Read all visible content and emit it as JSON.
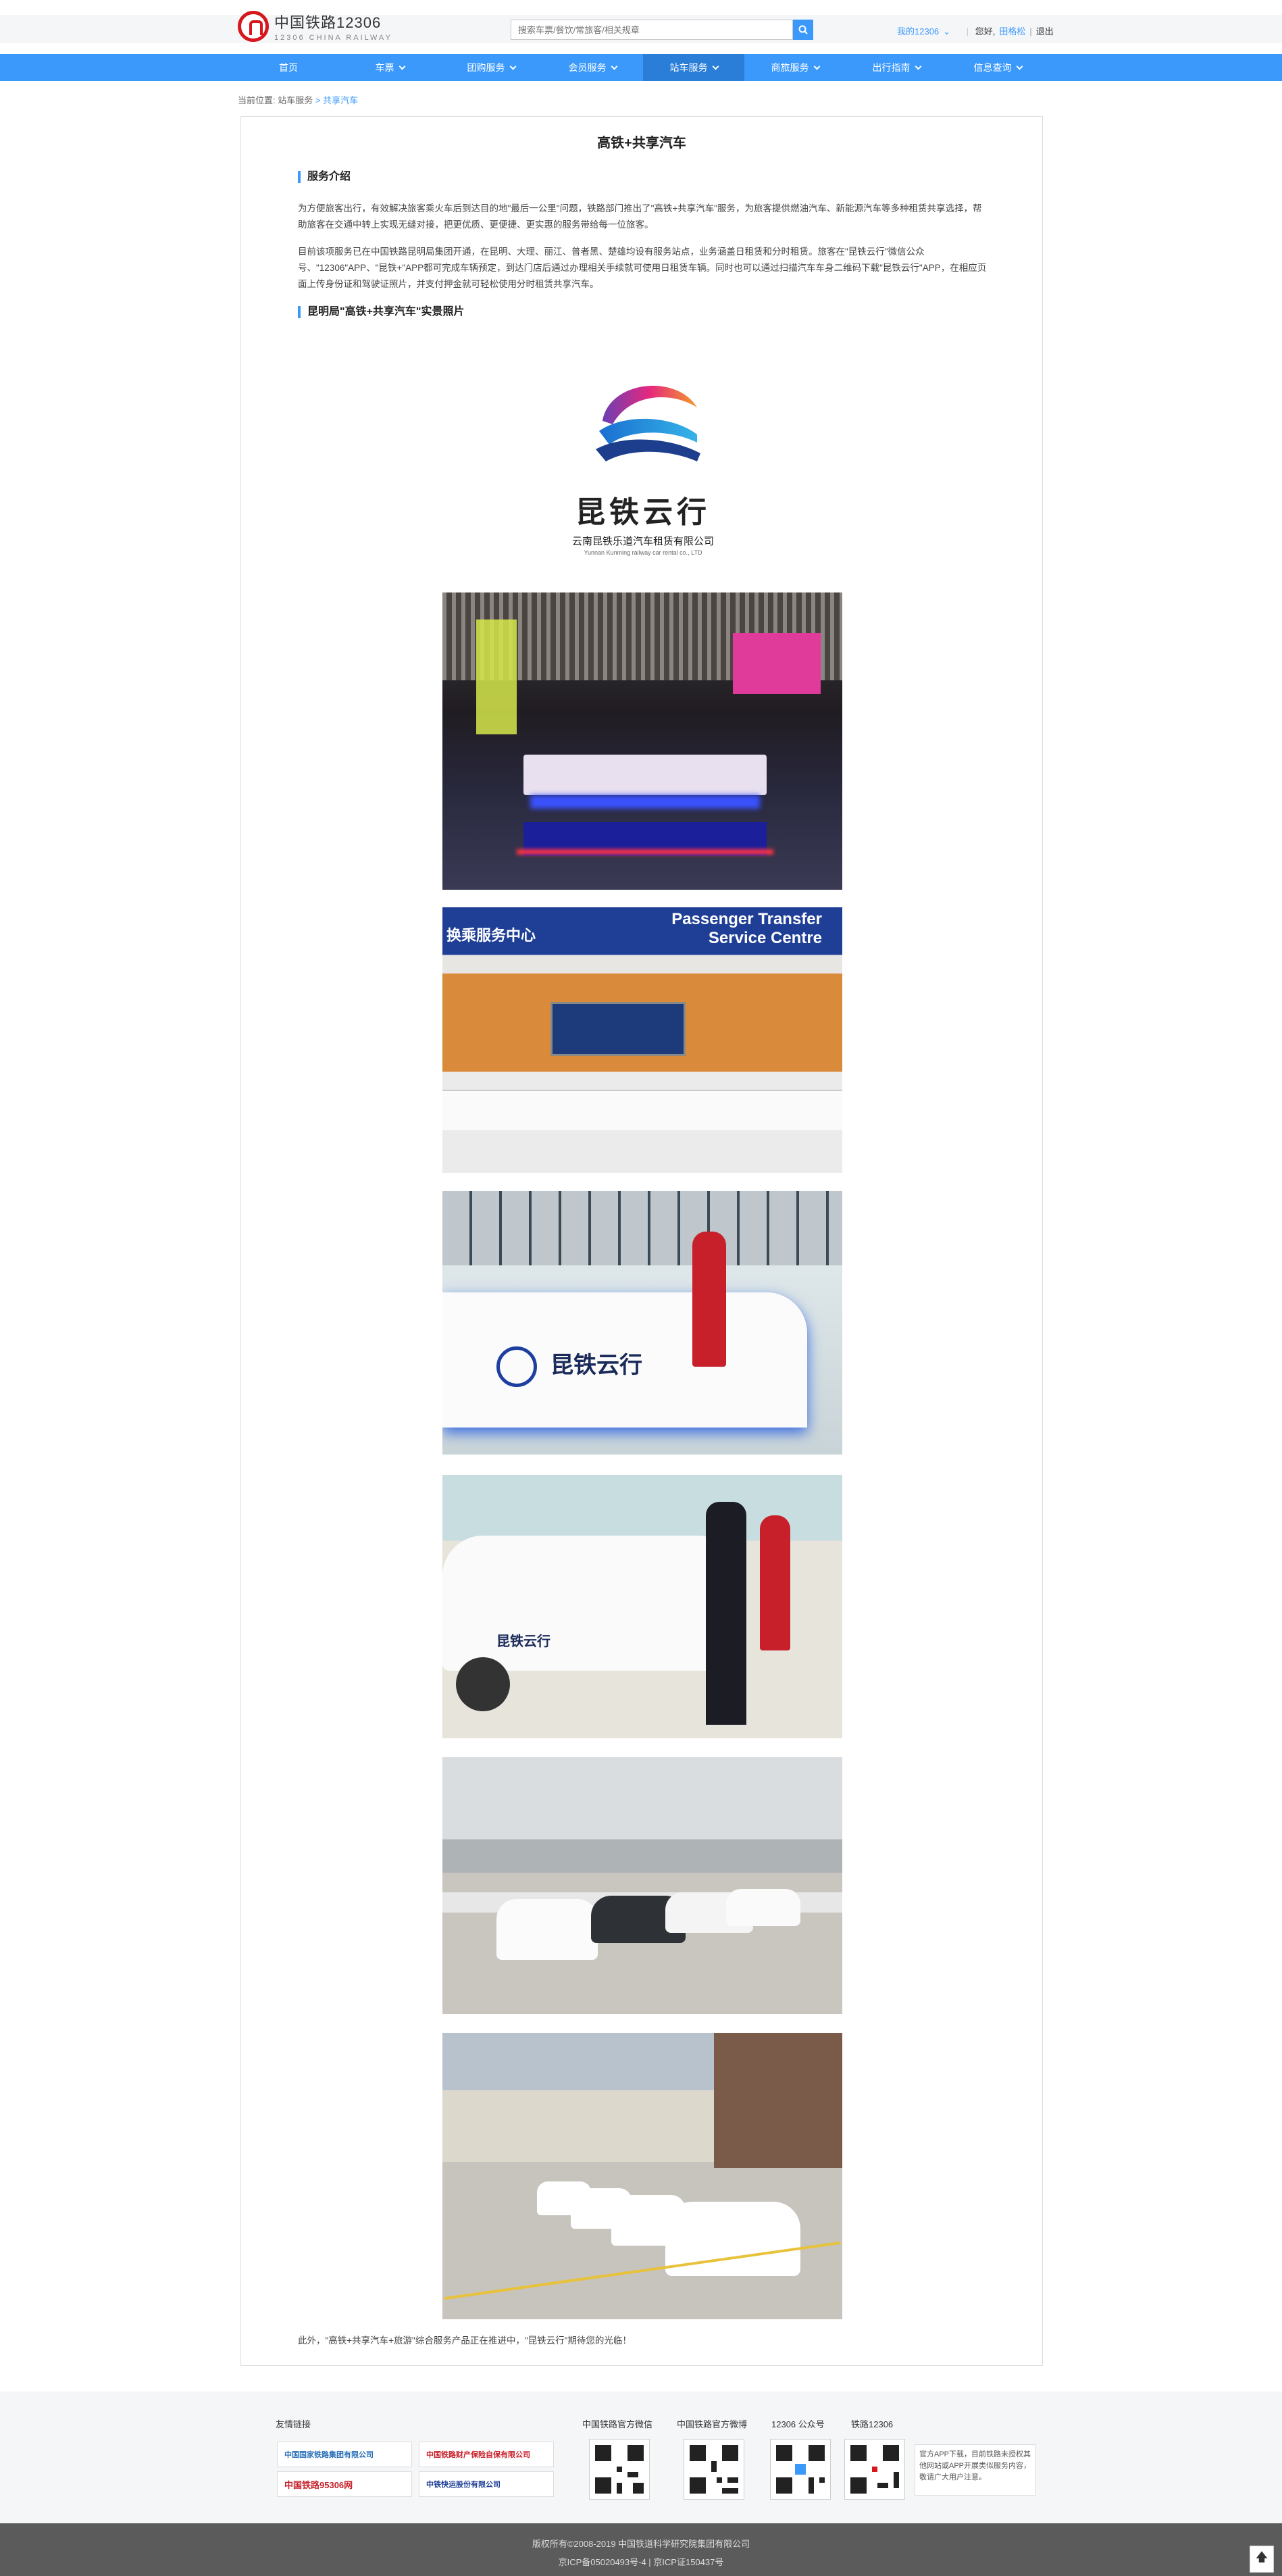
{
  "header": {
    "logo_title": "中国铁路12306",
    "logo_subtitle": "12306 CHINA RAILWAY",
    "search_placeholder": "搜索车票/餐饮/常旅客/相关规章",
    "my12306": "我的12306",
    "greeting": "您好,",
    "user": "田格松",
    "logout": "退出"
  },
  "nav": [
    "首页",
    "车票",
    "团购服务",
    "会员服务",
    "站车服务",
    "商旅服务",
    "出行指南",
    "信息查询"
  ],
  "breadcrumb": {
    "label": "当前位置:",
    "parent": "站车服务",
    "sep": ">",
    "current": "共享汽车"
  },
  "article": {
    "title": "高铁+共享汽车",
    "section1": "服务介绍",
    "para1": "为方便旅客出行，有效解决旅客乘火车后到达目的地\"最后一公里\"问题，铁路部门推出了\"高铁+共享汽车\"服务，为旅客提供燃油汽车、新能源汽车等多种租赁共享选择，帮助旅客在交通中转上实现无缝对接，把更优质、更便捷、更实惠的服务带给每一位旅客。",
    "para2": "目前该项服务已在中国铁路昆明局集团开通，在昆明、大理、丽江、普者黑、楚雄均设有服务站点，业务涵盖日租赁和分时租赁。旅客在\"昆铁云行\"微信公众号、\"12306\"APP、\"昆铁+\"APP都可完成车辆预定，到达门店后通过办理相关手续就可使用日租赁车辆。同时也可以通过扫描汽车车身二维码下载\"昆铁云行\"APP，在相应页面上传身份证和驾驶证照片，并支付押金就可轻松使用分时租赁共享汽车。",
    "section2": "昆明局\"高铁+共享汽车\"实景照片",
    "logo_brand": "昆铁云行",
    "logo_company": "云南昆铁乐道汽车租赁有限公司",
    "logo_company_en": "Yunnan Kunming railway car rental co., LTD",
    "photo2_sign": "Passenger Transfer Service Centre",
    "photo2_sign_cn": "换乘服务中心",
    "footnote": "此外，\"高铁+共享汽车+旅游\"综合服务产品正在推进中，\"昆铁云行\"期待您的光临！"
  },
  "footer": {
    "links_title": "友情链接",
    "links": [
      "中国国家铁路集团有限公司",
      "中国铁路财产保险自保有限公司",
      "中国铁路95306网",
      "中铁快运股份有限公司"
    ],
    "qr_titles": [
      "中国铁路官方微信",
      "中国铁路官方微博",
      "12306 公众号",
      "铁路12306"
    ],
    "app_text": "官方APP下载，目前铁路未授权其他网站或APP开展类似服务内容，敬请广大用户注意。",
    "copyright": "版权所有©2008-2019   中国铁道科学研究院集团有限公司",
    "icp": "京ICP备05020493号-4   |   京ICP证150437号"
  },
  "colors": {
    "accent": "#3b99fc",
    "brand_red": "#d6181e"
  }
}
